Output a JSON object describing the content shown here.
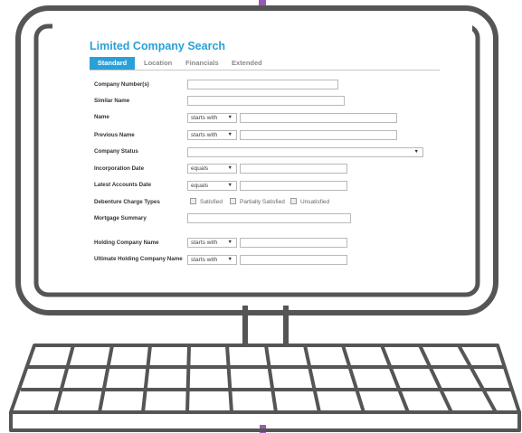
{
  "page_title": "Limited Company Search",
  "tabs": [
    {
      "label": "Standard",
      "active": true
    },
    {
      "label": "Location",
      "active": false
    },
    {
      "label": "Financials",
      "active": false
    },
    {
      "label": "Extended",
      "active": false
    }
  ],
  "labels": {
    "company_numbers": "Company Number(s)",
    "similar_name": "Similar Name",
    "name": "Name",
    "previous_name": "Previous Name",
    "company_status": "Company Status",
    "incorporation_date": "Incorporation Date",
    "latest_accounts_date": "Latest Accounts Date",
    "debenture_charge_types": "Debenture Charge Types",
    "mortgage_summary": "Mortgage Summary",
    "holding_company_name": "Holding Company Name",
    "ultimate_holding_company_name": "Ultimate Holding Company Name"
  },
  "selects": {
    "name_mode": "starts with",
    "previous_name_mode": "starts with",
    "incorporation_date_mode": "equals",
    "latest_accounts_date_mode": "equals",
    "holding_company_mode": "starts with",
    "ultimate_holding_company_mode": "starts with"
  },
  "checkboxes": [
    {
      "label": "Satisfied",
      "checked": false
    },
    {
      "label": "Partially Satisfied",
      "checked": false
    },
    {
      "label": "Unsatisfied",
      "checked": false
    }
  ],
  "icons": {
    "dropdown": "triangle-down-icon",
    "checkbox": "checkbox-icon"
  },
  "colors": {
    "accent": "#2aa0d8",
    "monitor_stroke": "#555555",
    "cable_accent": "#9b59b6"
  }
}
